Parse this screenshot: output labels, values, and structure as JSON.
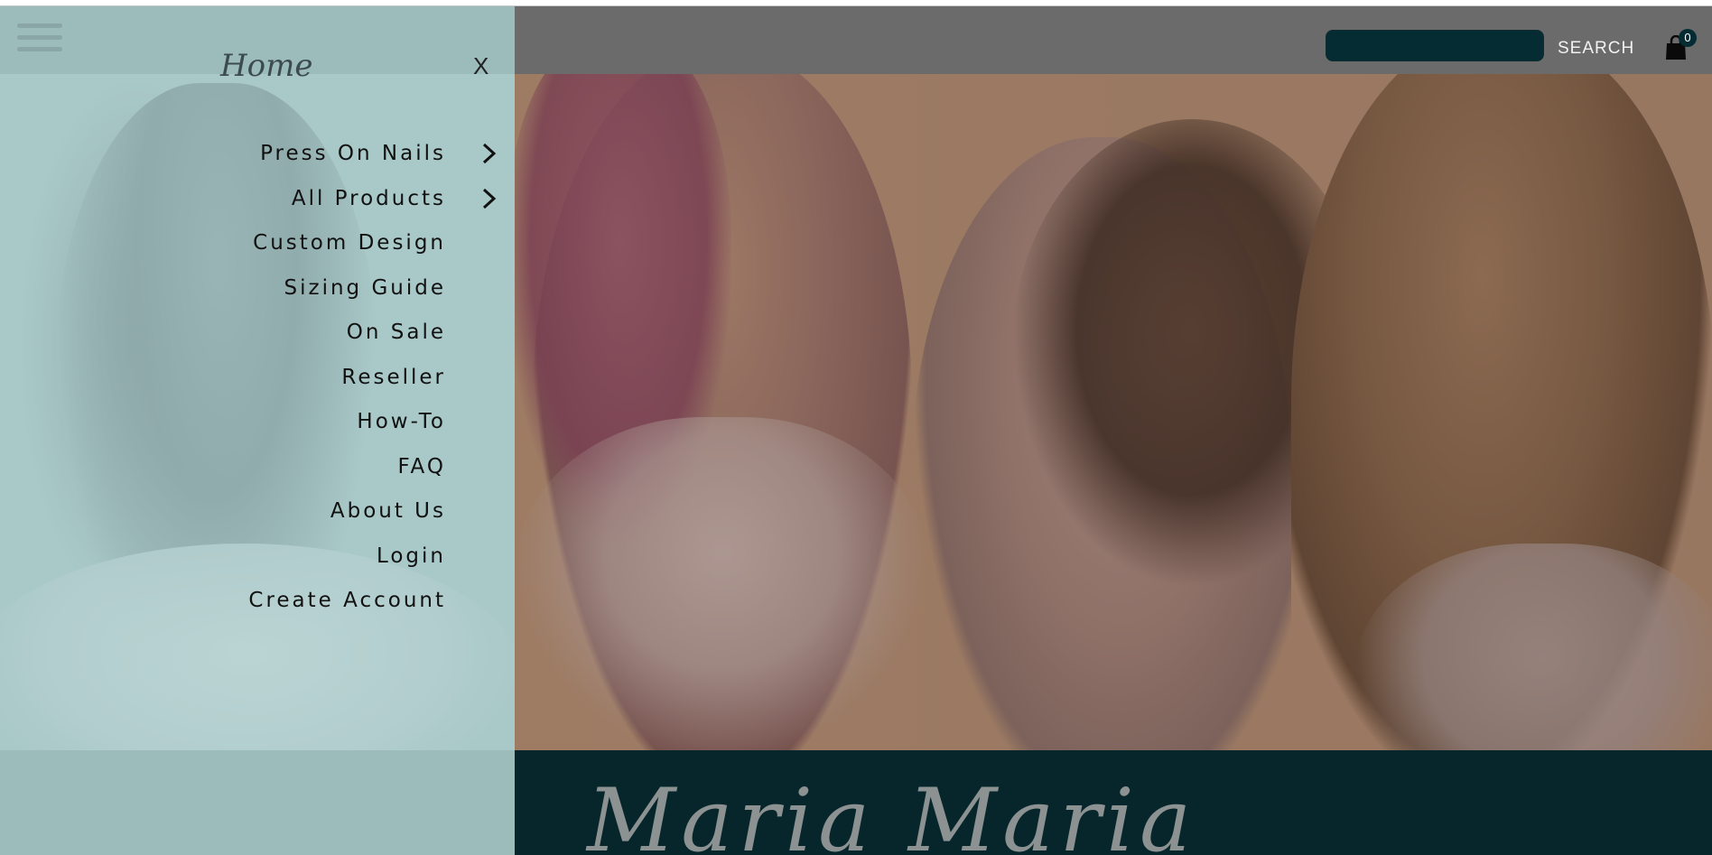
{
  "header": {
    "search_value": "",
    "search_label": "SEARCH",
    "cart_count": "0"
  },
  "drawer": {
    "title": "Home",
    "close_label": "X",
    "items": [
      {
        "label": "Press On Nails",
        "has_submenu": true
      },
      {
        "label": "All Products",
        "has_submenu": true
      },
      {
        "label": "Custom Design",
        "has_submenu": false
      },
      {
        "label": "Sizing Guide",
        "has_submenu": false
      },
      {
        "label": "On Sale",
        "has_submenu": false
      },
      {
        "label": "Reseller",
        "has_submenu": false
      },
      {
        "label": "How-To",
        "has_submenu": false
      },
      {
        "label": "FAQ",
        "has_submenu": false
      },
      {
        "label": "About Us",
        "has_submenu": false
      },
      {
        "label": "Login",
        "has_submenu": false
      },
      {
        "label": "Create Account",
        "has_submenu": false
      }
    ]
  },
  "brand": {
    "band_title": "Maria Maria"
  },
  "colors": {
    "drawer_bg": "#9cbcbc",
    "header_overlay": "#6b6b6b",
    "accent_dark": "#06262c",
    "text_dark": "#111111"
  },
  "icons": {
    "menu": "hamburger-icon",
    "submenu": "chevron-right-icon",
    "cart": "shopping-bag-icon"
  }
}
